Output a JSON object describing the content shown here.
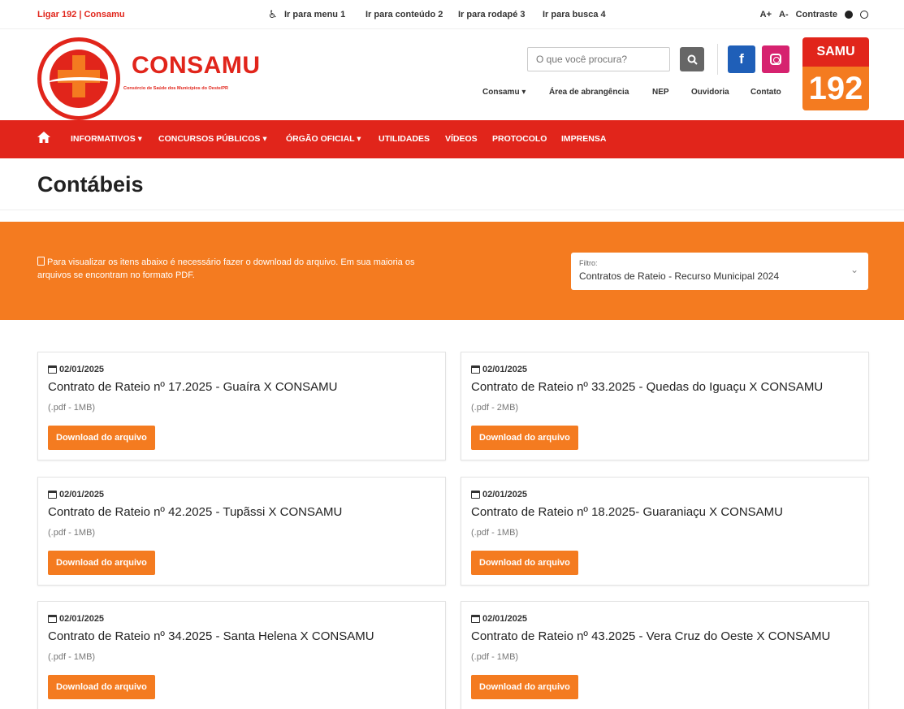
{
  "topbar": {
    "call_label": "Ligar 192 | Consamu",
    "skip_menu": "Ir para menu 1",
    "skip_content": "Ir para conteúdo 2",
    "skip_footer": "Ir para rodapé 3",
    "skip_search": "Ir para busca 4",
    "font_increase": "A+",
    "font_decrease": "A-",
    "contrast_label": "Contraste"
  },
  "header": {
    "brand": "CONSAMU",
    "brand_subtitle": "Consórcio de Saúde dos Municípios do Oeste/PR",
    "search_placeholder": "O que você procura?",
    "facebook_letter": "f",
    "samu_top": "SAMU",
    "samu_number": "192",
    "nav": [
      {
        "label": "Consamu ▾"
      },
      {
        "label": "Área de abrangência"
      },
      {
        "label": "NEP"
      },
      {
        "label": "Ouvidoria"
      },
      {
        "label": "Contato"
      }
    ]
  },
  "mainnav": [
    {
      "label": "INFORMATIVOS ▾"
    },
    {
      "label": "CONCURSOS PÚBLICOS ▾"
    },
    {
      "label": "ÓRGÃO OFICIAL ▾"
    },
    {
      "label": "UTILIDADES"
    },
    {
      "label": "VÍDEOS"
    },
    {
      "label": "PROTOCOLO"
    },
    {
      "label": "IMPRENSA"
    }
  ],
  "page_title": "Contábeis",
  "banner": {
    "notice": "Para visualizar os itens abaixo é necessário fazer o download do arquivo. Em sua maioria os arquivos se encontram no formato PDF.",
    "filter_label": "Filtro:",
    "filter_value": "Contratos de Rateio - Recurso Municipal 2024"
  },
  "cards": [
    {
      "date": "02/01/2025",
      "title": "Contrato de Rateio nº 17.2025 - Guaíra X CONSAMU",
      "meta": "(.pdf - 1MB)",
      "button": "Download do arquivo"
    },
    {
      "date": "02/01/2025",
      "title": "Contrato de Rateio nº 33.2025 - Quedas do Iguaçu X CONSAMU",
      "meta": "(.pdf - 2MB)",
      "button": "Download do arquivo"
    },
    {
      "date": "02/01/2025",
      "title": "Contrato de Rateio nº 42.2025 - Tupãssi X CONSAMU",
      "meta": "(.pdf - 1MB)",
      "button": "Download do arquivo"
    },
    {
      "date": "02/01/2025",
      "title": "Contrato de Rateio nº 18.2025- Guaraniaçu X CONSAMU",
      "meta": "(.pdf - 1MB)",
      "button": "Download do arquivo"
    },
    {
      "date": "02/01/2025",
      "title": "Contrato de Rateio nº 34.2025 - Santa Helena X CONSAMU",
      "meta": "(.pdf - 1MB)",
      "button": "Download do arquivo"
    },
    {
      "date": "02/01/2025",
      "title": "Contrato de Rateio nº 43.2025 - Vera Cruz do Oeste X CONSAMU",
      "meta": "(.pdf - 1MB)",
      "button": "Download do arquivo"
    }
  ],
  "colors": {
    "primary_red": "#e1251b",
    "accent_orange": "#f47b20",
    "facebook_blue": "#1f5fb8",
    "instagram_pink": "#d6226f"
  }
}
